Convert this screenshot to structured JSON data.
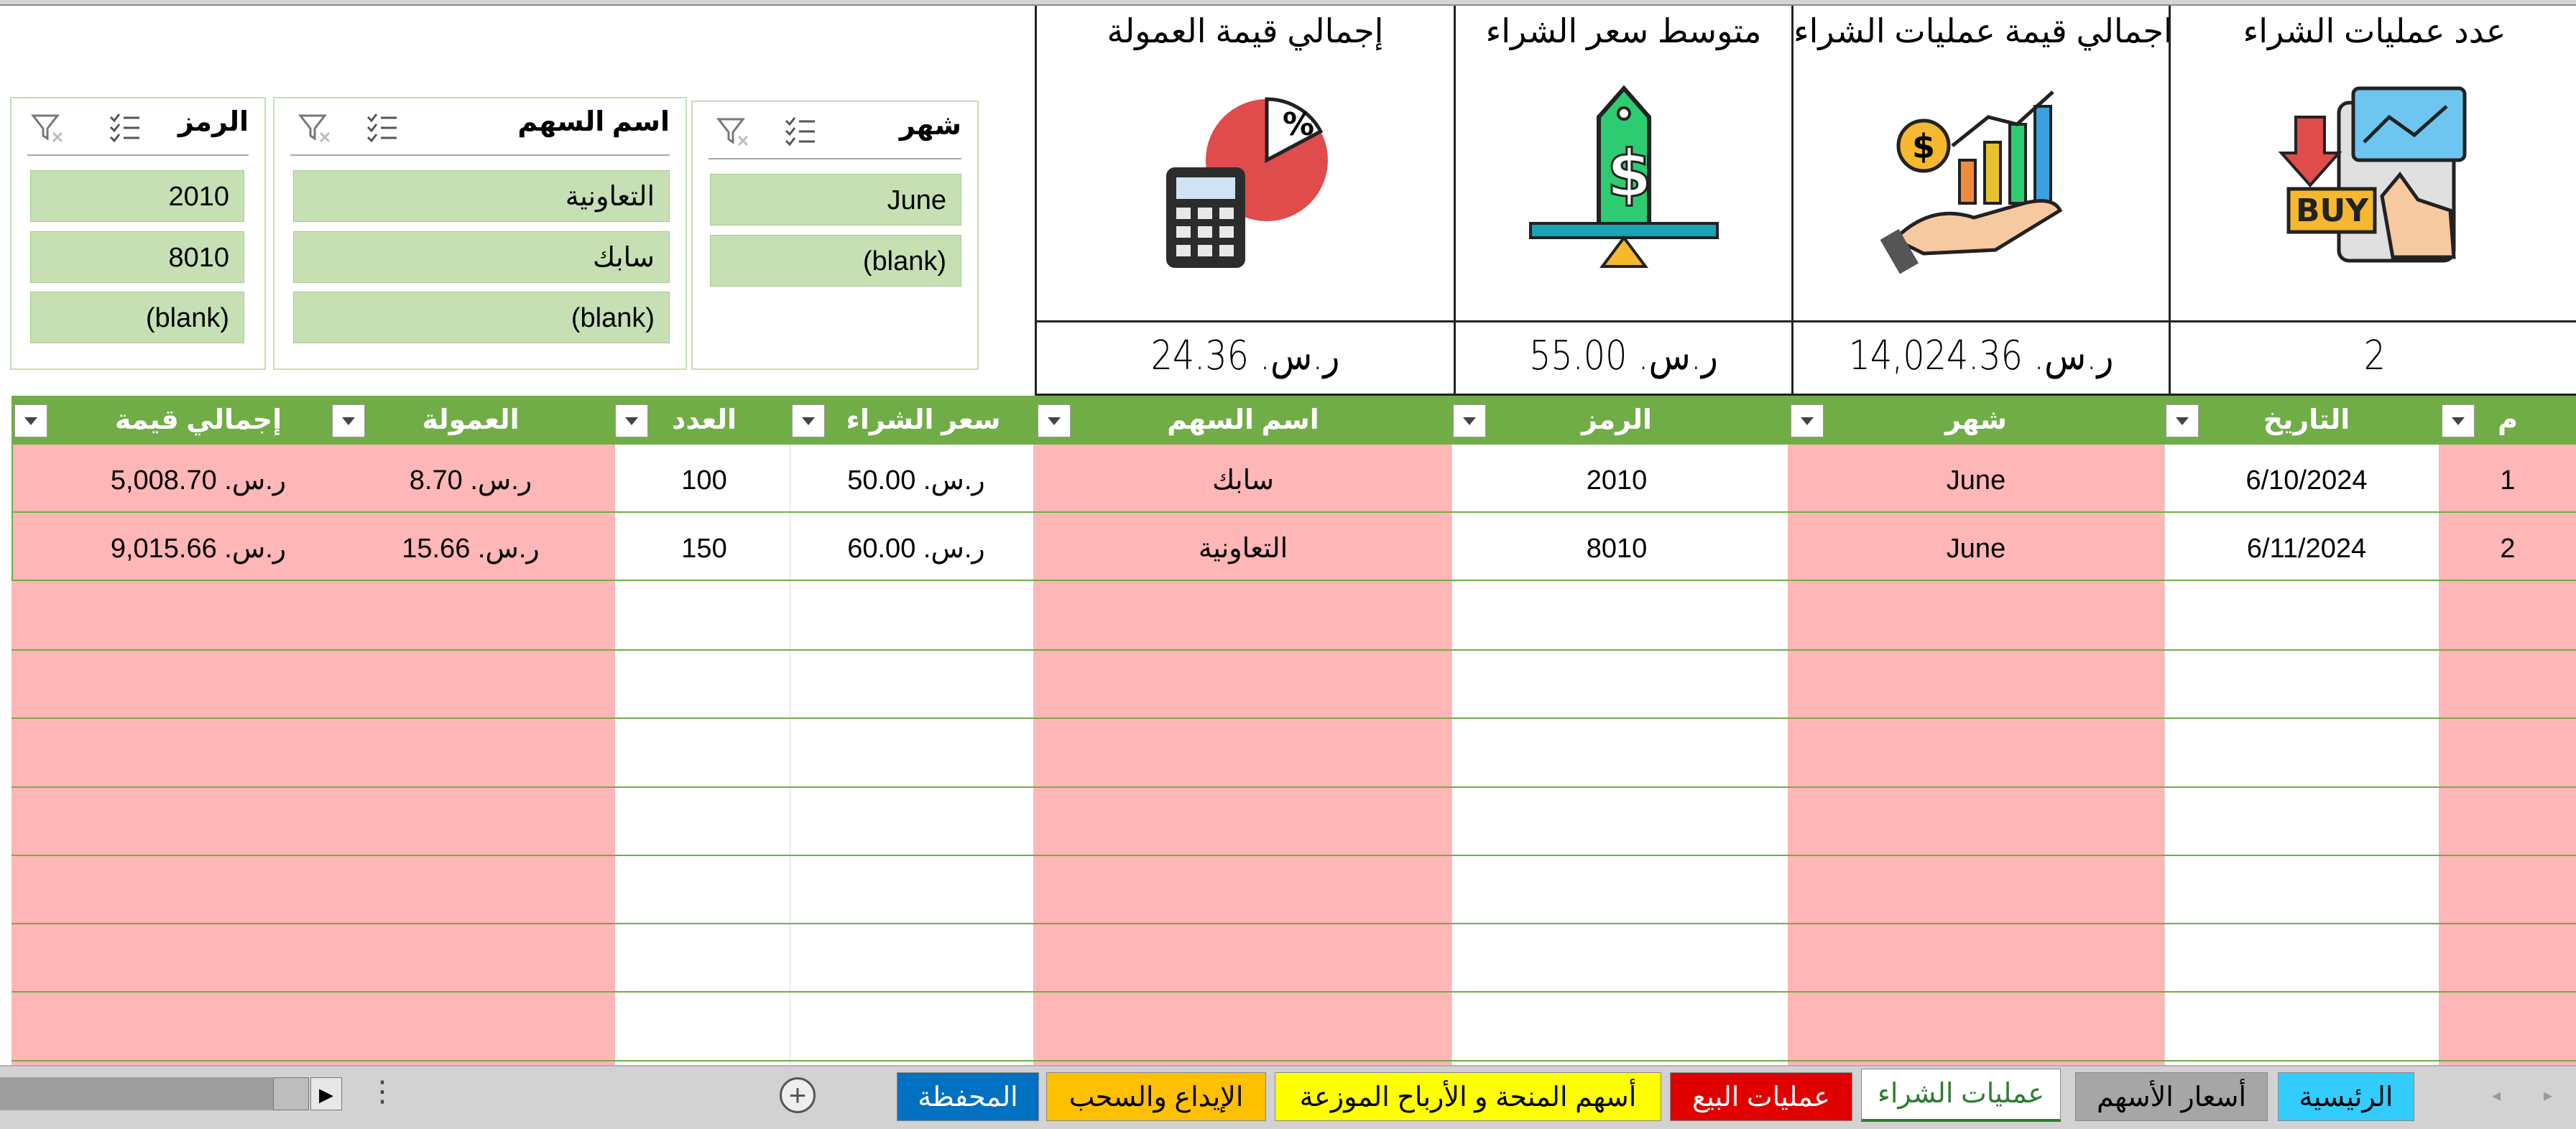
{
  "kpis": [
    {
      "title": "عدد عمليات الشراء",
      "value": "2",
      "icon": "buy-touch-icon"
    },
    {
      "title": "اجمالي قيمة عمليات الشراء",
      "value": "ر.س. 14,024.36",
      "icon": "money-growth-icon"
    },
    {
      "title": "متوسط سعر الشراء",
      "value": "ر.س. 55.00",
      "icon": "price-tag-balance-icon"
    },
    {
      "title": "إجمالي قيمة العمولة",
      "value": "ر.س. 24.36",
      "icon": "calculator-pie-icon"
    }
  ],
  "slicers": [
    {
      "title": "شهر",
      "items": [
        "June",
        "(blank)"
      ]
    },
    {
      "title": "اسم السهم",
      "items": [
        "التعاونية",
        "سابك",
        "(blank)"
      ]
    },
    {
      "title": "الرمز",
      "items": [
        "2010",
        "8010",
        "(blank)"
      ]
    }
  ],
  "table": {
    "headers": [
      "م",
      "التاريخ",
      "شهر",
      "الرمز",
      "اسم السهم",
      "سعر الشراء",
      "العدد",
      "العمولة",
      "إجمالي قيمة الشراء"
    ],
    "rows": [
      [
        "1",
        "6/10/2024",
        "June",
        "2010",
        "سابك",
        "ر.س. 50.00",
        "100",
        "ر.س. 8.70",
        "ر.س. 5,008.70"
      ],
      [
        "2",
        "6/11/2024",
        "June",
        "8010",
        "التعاونية",
        "ر.س. 60.00",
        "150",
        "ر.س. 15.66",
        "ر.س. 9,015.66"
      ]
    ]
  },
  "tabs": [
    {
      "label": "الرئيسية",
      "bg": "#33ccff",
      "fg": "#000000"
    },
    {
      "label": "أسعار الأسهم",
      "bg": "#a6a6a6",
      "fg": "#000000"
    },
    {
      "label": "عمليات الشراء",
      "bg": "#ffffff",
      "fg": "#2e7d32",
      "active": true
    },
    {
      "label": "عمليات البيع",
      "bg": "#e00000",
      "fg": "#ffffff"
    },
    {
      "label": "أسهم المنحة و الأرباح الموزعة",
      "bg": "#ffff00",
      "fg": "#000000"
    },
    {
      "label": "الإيداع والسحب",
      "bg": "#ffc000",
      "fg": "#000000"
    },
    {
      "label": "المحفظة",
      "bg": "#0070c0",
      "fg": "#ffffff"
    }
  ],
  "colors": {
    "header_green": "#70ad47",
    "band_pink": "#ffb6b6",
    "slicer_item": "#c6e0b4"
  }
}
